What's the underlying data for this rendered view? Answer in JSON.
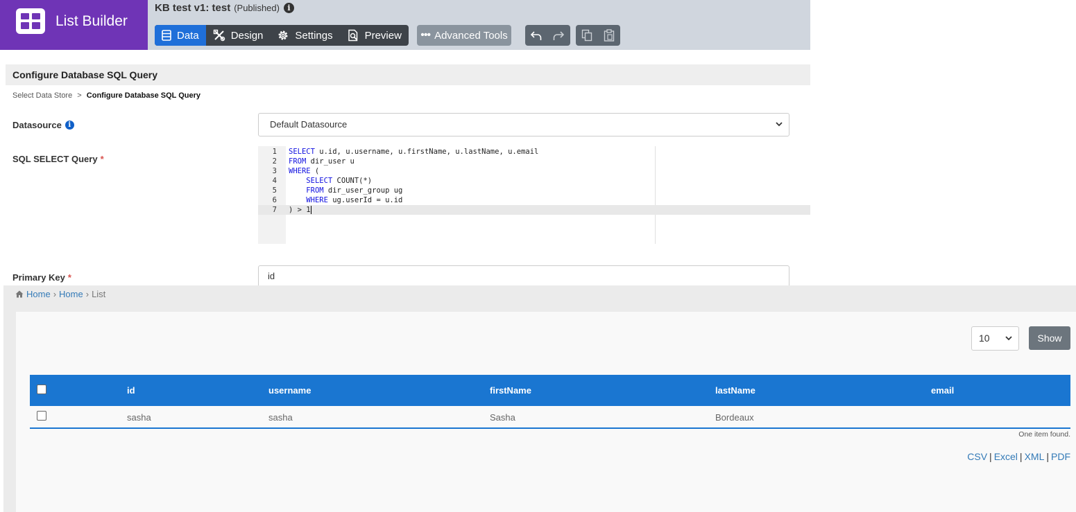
{
  "brand": {
    "title": "List Builder",
    "icon": "grid-icon",
    "color": "#6f34b6"
  },
  "app": {
    "title": "KB test v1: test",
    "status": "(Published)"
  },
  "tabs": [
    {
      "label": "Data",
      "icon": "table-icon",
      "active": true
    },
    {
      "label": "Design",
      "icon": "design-tools-icon"
    },
    {
      "label": "Settings",
      "icon": "gear-icon"
    },
    {
      "label": "Preview",
      "icon": "preview-icon"
    }
  ],
  "toolbar": {
    "advanced_label": "Advanced Tools",
    "icons": [
      "undo-icon",
      "redo-icon",
      "copy-icon",
      "paste-icon"
    ]
  },
  "section": {
    "title": "Configure Database SQL Query",
    "breadcrumb": {
      "parent": "Select Data Store",
      "separator": ">",
      "current": "Configure Database SQL Query"
    }
  },
  "form": {
    "datasource_label": "Datasource",
    "datasource_value": "Default Datasource",
    "sql_label": "SQL SELECT Query",
    "required_mark": "*",
    "primary_key_label": "Primary Key",
    "primary_key_value": "id",
    "sql_lines": [
      {
        "num": "1",
        "kw": "SELECT",
        "rest": " u.id, u.username, u.firstName, u.lastName, u.email"
      },
      {
        "num": "2",
        "kw": "FROM",
        "rest": " dir_user u"
      },
      {
        "num": "3",
        "kw": "WHERE",
        "rest": " ("
      },
      {
        "num": "4",
        "indent": "    ",
        "kw": "SELECT",
        "rest": " COUNT(*)"
      },
      {
        "num": "5",
        "indent": "    ",
        "kw": "FROM",
        "rest": " dir_user_group ug"
      },
      {
        "num": "6",
        "indent": "    ",
        "kw": "WHERE",
        "rest": " ug.userId = u.id"
      },
      {
        "num": "7",
        "kw": "",
        "rest": ") > 1"
      }
    ]
  },
  "preview": {
    "breadcrumb": [
      "Home",
      "Home",
      "List"
    ],
    "page_size": "10",
    "show_label": "Show",
    "columns": [
      "id",
      "username",
      "firstName",
      "lastName",
      "email"
    ],
    "rows": [
      {
        "id": "sasha",
        "username": "sasha",
        "firstName": "Sasha",
        "lastName": "Bordeaux",
        "email": ""
      }
    ],
    "found_text": "One item found.",
    "exports": [
      "CSV",
      "Excel",
      "XML",
      "PDF"
    ],
    "accent": "#1a76d1"
  }
}
